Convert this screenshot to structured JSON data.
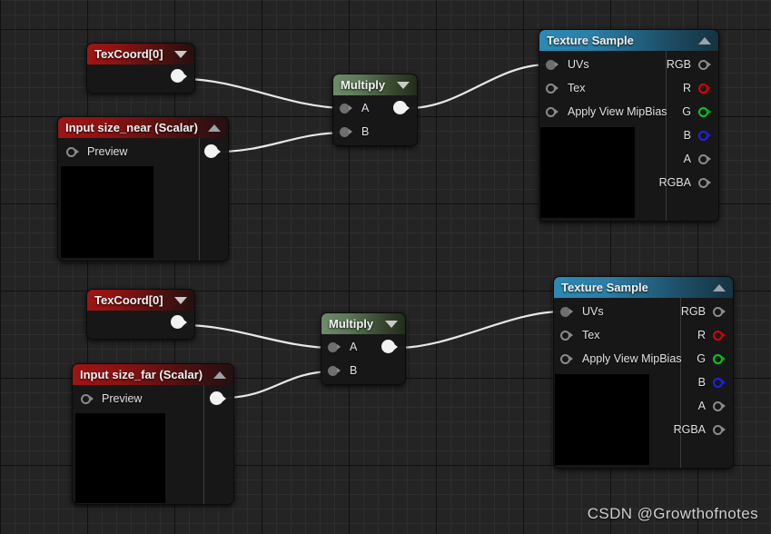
{
  "editor": {
    "name": "Unreal Material Editor Graph",
    "background_color": "#242424",
    "grid_minor_color": "#2e2e2e",
    "grid_major_color": "#111111",
    "wire_color": "#e8e8e8"
  },
  "watermark": {
    "text": "CSDN @Growthofnotes"
  },
  "nodes": [
    {
      "id": "texcoord-near",
      "title": "TexCoord[0]",
      "header_color": "#9e1515",
      "collapse_icon": "chevron-down-icon",
      "inputs": [],
      "outputs": [
        {
          "label": "",
          "pin": "white"
        }
      ]
    },
    {
      "id": "input-size-near",
      "title": "Input size_near (Scalar)",
      "header_color": "#9e1515",
      "collapse_icon": "chevron-up-icon",
      "inputs": [
        {
          "label": "Preview",
          "pin": "hollow"
        }
      ],
      "outputs": [
        {
          "label": "",
          "pin": "white"
        }
      ],
      "has_preview_swatch": true
    },
    {
      "id": "multiply-near",
      "title": "Multiply",
      "header_color": "#6e8a6a",
      "collapse_icon": "chevron-down-icon",
      "inputs": [
        {
          "label": "A",
          "pin": "filled"
        },
        {
          "label": "B",
          "pin": "filled"
        }
      ],
      "outputs": [
        {
          "label": "",
          "pin": "white"
        }
      ]
    },
    {
      "id": "texture-sample-near",
      "title": "Texture Sample",
      "header_color": "#2c89b5",
      "collapse_icon": "chevron-up-icon",
      "inputs": [
        {
          "label": "UVs",
          "pin": "filled"
        },
        {
          "label": "Tex",
          "pin": "hollow"
        },
        {
          "label": "Apply View MipBias",
          "pin": "hollow"
        }
      ],
      "outputs": [
        {
          "label": "RGB",
          "pin": "hollow"
        },
        {
          "label": "R",
          "pin": "r"
        },
        {
          "label": "G",
          "pin": "g"
        },
        {
          "label": "B",
          "pin": "b"
        },
        {
          "label": "A",
          "pin": "hollow"
        },
        {
          "label": "RGBA",
          "pin": "hollow"
        }
      ],
      "has_preview_swatch": true
    },
    {
      "id": "texcoord-far",
      "title": "TexCoord[0]",
      "header_color": "#9e1515",
      "collapse_icon": "chevron-down-icon",
      "inputs": [],
      "outputs": [
        {
          "label": "",
          "pin": "white"
        }
      ]
    },
    {
      "id": "input-size-far",
      "title": "Input size_far (Scalar)",
      "header_color": "#9e1515",
      "collapse_icon": "chevron-up-icon",
      "inputs": [
        {
          "label": "Preview",
          "pin": "hollow"
        }
      ],
      "outputs": [
        {
          "label": "",
          "pin": "white"
        }
      ],
      "has_preview_swatch": true
    },
    {
      "id": "multiply-far",
      "title": "Multiply",
      "header_color": "#6e8a6a",
      "collapse_icon": "chevron-down-icon",
      "inputs": [
        {
          "label": "A",
          "pin": "filled"
        },
        {
          "label": "B",
          "pin": "filled"
        }
      ],
      "outputs": [
        {
          "label": "",
          "pin": "white"
        }
      ]
    },
    {
      "id": "texture-sample-far",
      "title": "Texture Sample",
      "header_color": "#2c89b5",
      "collapse_icon": "chevron-up-icon",
      "inputs": [
        {
          "label": "UVs",
          "pin": "filled"
        },
        {
          "label": "Tex",
          "pin": "hollow"
        },
        {
          "label": "Apply View MipBias",
          "pin": "hollow"
        }
      ],
      "outputs": [
        {
          "label": "RGB",
          "pin": "hollow"
        },
        {
          "label": "R",
          "pin": "r"
        },
        {
          "label": "G",
          "pin": "g"
        },
        {
          "label": "B",
          "pin": "b"
        },
        {
          "label": "A",
          "pin": "hollow"
        },
        {
          "label": "RGBA",
          "pin": "hollow"
        }
      ],
      "has_preview_swatch": true
    }
  ],
  "labels": {
    "texcoord_near_title": "TexCoord[0]",
    "texcoord_far_title": "TexCoord[0]",
    "input_near_title": "Input size_near (Scalar)",
    "input_far_title": "Input size_far (Scalar)",
    "multiply_near_title": "Multiply",
    "multiply_far_title": "Multiply",
    "texsample_near_title": "Texture Sample",
    "texsample_far_title": "Texture Sample",
    "preview_near": "Preview",
    "preview_far": "Preview",
    "mul_near_a": "A",
    "mul_near_b": "B",
    "mul_far_a": "A",
    "mul_far_b": "B",
    "ts_uvs": "UVs",
    "ts_tex": "Tex",
    "ts_mipbias": "Apply View MipBias",
    "ts_rgb": "RGB",
    "ts_r": "R",
    "ts_g": "G",
    "ts_b": "B",
    "ts_a": "A",
    "ts_rgba": "RGBA",
    "ts2_uvs": "UVs",
    "ts2_tex": "Tex",
    "ts2_mipbias": "Apply View MipBias",
    "ts2_rgb": "RGB",
    "ts2_r": "R",
    "ts2_g": "G",
    "ts2_b": "B",
    "ts2_a": "A",
    "ts2_rgba": "RGBA"
  }
}
